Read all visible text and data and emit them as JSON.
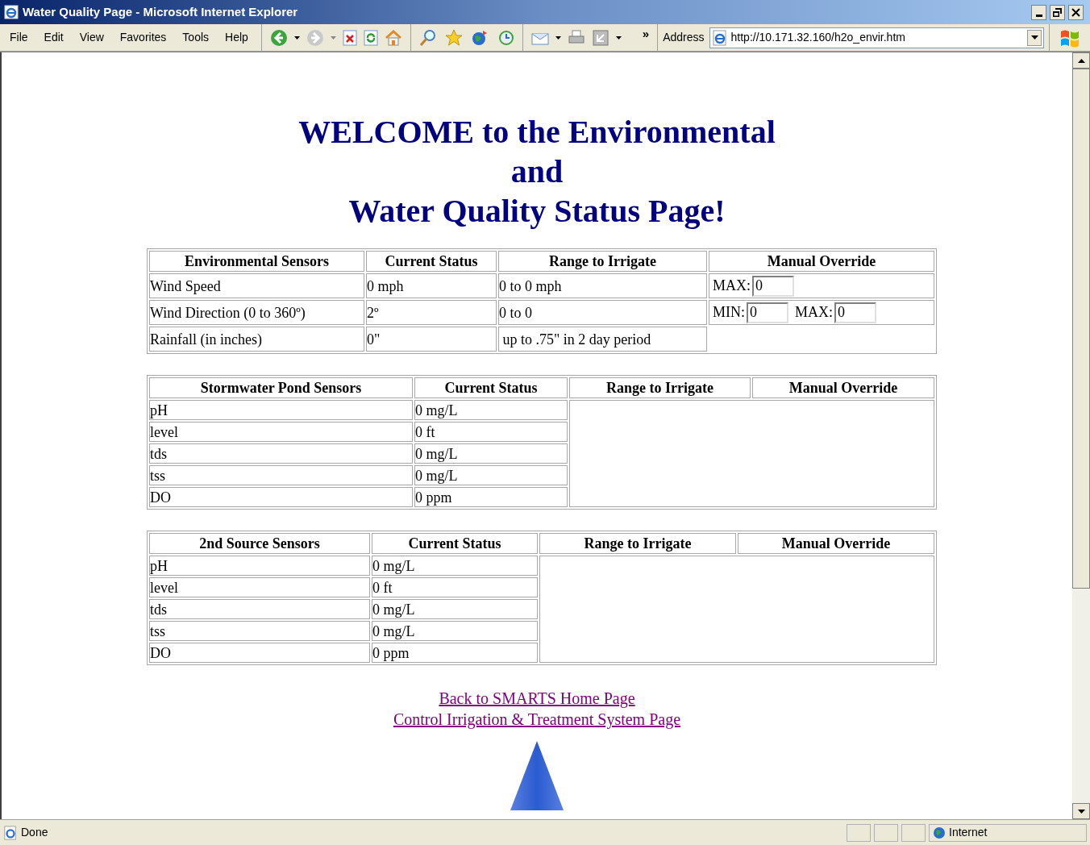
{
  "window": {
    "title": "Water Quality Page - Microsoft Internet Explorer"
  },
  "menu": [
    "File",
    "Edit",
    "View",
    "Favorites",
    "Tools",
    "Help"
  ],
  "toolbar": {
    "more": "»",
    "address_label": "Address",
    "url": "http://10.171.32.160/h2o_envir.htm"
  },
  "heading": [
    "WELCOME to the Environmental",
    "and",
    "Water Quality Status Page!"
  ],
  "environment_table": {
    "columns": [
      "Environmental Sensors",
      "Current Status",
      "Range to Irrigate",
      "Manual Override"
    ],
    "rows": [
      {
        "sensor": "Wind Speed",
        "status": "0 mph",
        "range": "0 to 0 mph",
        "override": [
          {
            "label": "MAX:",
            "value": "0"
          }
        ]
      },
      {
        "sensor": "Wind Direction (0 to 360º)",
        "status": "2º",
        "range": "0 to 0",
        "override": [
          {
            "label": "MIN:",
            "value": "0"
          },
          {
            "label": "MAX:",
            "value": "0"
          }
        ]
      },
      {
        "sensor": "Rainfall (in inches)",
        "status": "0\"",
        "range": " up to .75\" in 2 day period",
        "override": []
      }
    ]
  },
  "sensor_tables": [
    {
      "columns": [
        "Stormwater Pond Sensors",
        "Current Status",
        "Range to Irrigate",
        "Manual Override"
      ],
      "rows": [
        [
          "pH",
          "0 mg/L"
        ],
        [
          "level",
          "0 ft"
        ],
        [
          "tds",
          "0 mg/L"
        ],
        [
          "tss",
          "0 mg/L"
        ],
        [
          "DO",
          "0 ppm"
        ]
      ]
    },
    {
      "columns": [
        "2nd Source Sensors",
        "Current Status",
        "Range to Irrigate",
        "Manual Override"
      ],
      "rows": [
        [
          "pH",
          "0 mg/L"
        ],
        [
          "level",
          "0 ft"
        ],
        [
          "tds",
          "0 mg/L"
        ],
        [
          "tss",
          "0 mg/L"
        ],
        [
          "DO",
          "0 ppm"
        ]
      ]
    }
  ],
  "links": [
    "Back to SMARTS Home Page",
    "Control Irrigation & Treatment System Page"
  ],
  "status_bar": {
    "text": "Done",
    "zone": "Internet"
  }
}
